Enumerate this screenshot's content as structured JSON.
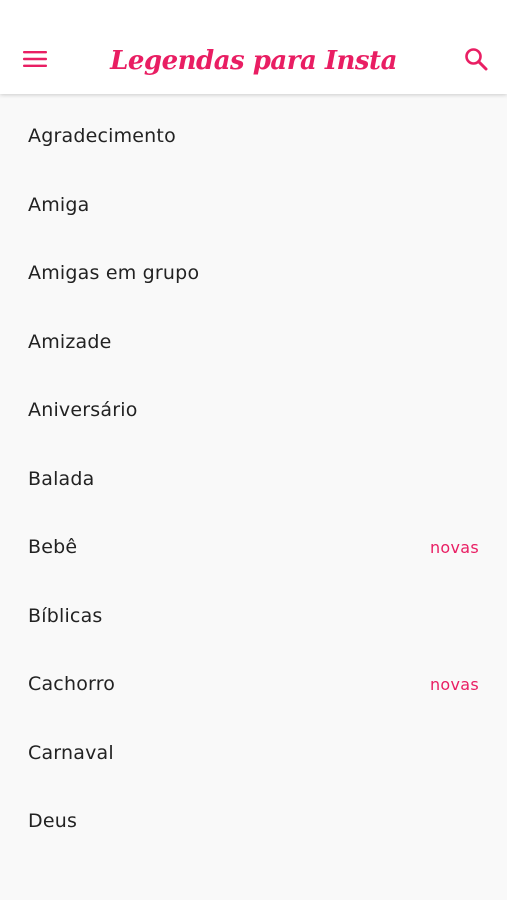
{
  "header": {
    "title": "Legendas para Insta",
    "menu_icon": "hamburger-menu-icon",
    "search_icon": "search-icon"
  },
  "colors": {
    "accent": "#e91e63",
    "background": "#f9f9f9",
    "header_background": "#ffffff",
    "text": "#222222"
  },
  "categories": [
    {
      "label": "Agradecimento",
      "badge": ""
    },
    {
      "label": "Amiga",
      "badge": ""
    },
    {
      "label": "Amigas em grupo",
      "badge": ""
    },
    {
      "label": "Amizade",
      "badge": ""
    },
    {
      "label": "Aniversário",
      "badge": ""
    },
    {
      "label": "Balada",
      "badge": ""
    },
    {
      "label": "Bebê",
      "badge": "novas"
    },
    {
      "label": "Bíblicas",
      "badge": ""
    },
    {
      "label": "Cachorro",
      "badge": "novas"
    },
    {
      "label": "Carnaval",
      "badge": ""
    },
    {
      "label": "Deus",
      "badge": ""
    }
  ]
}
